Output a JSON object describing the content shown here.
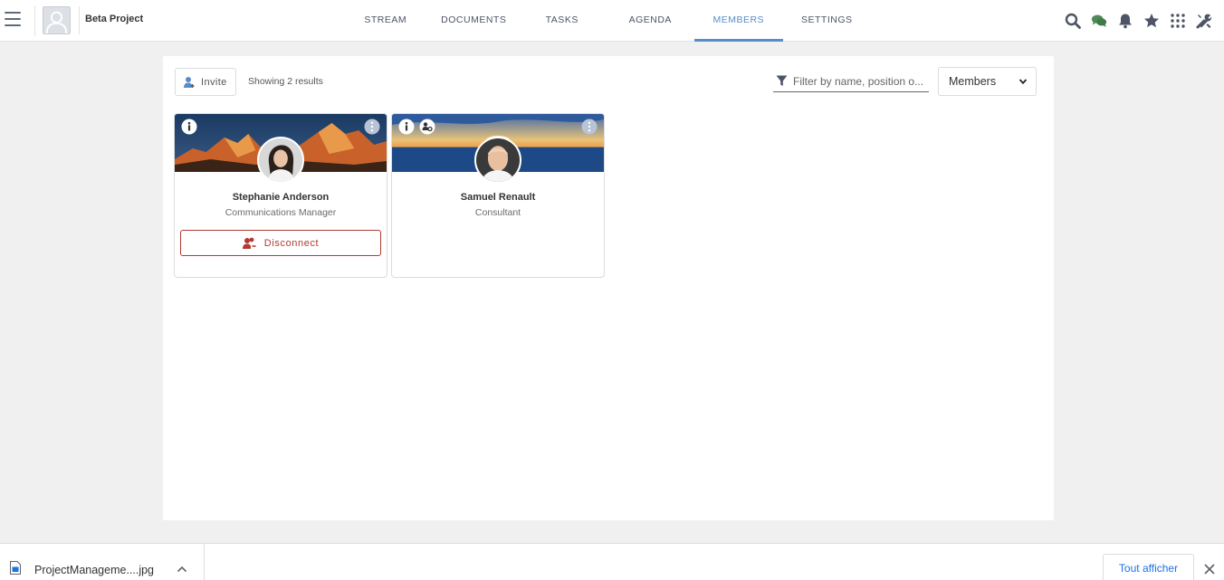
{
  "space": {
    "title": "Beta Project"
  },
  "nav": {
    "tabs": [
      {
        "label": "STREAM",
        "active": false
      },
      {
        "label": "DOCUMENTS",
        "active": false
      },
      {
        "label": "TASKS",
        "active": false
      },
      {
        "label": "AGENDA",
        "active": false
      },
      {
        "label": "MEMBERS",
        "active": true
      },
      {
        "label": "SETTINGS",
        "active": false
      }
    ]
  },
  "top_icons": [
    "search-icon",
    "chat-icon",
    "bell-icon",
    "star-icon",
    "apps-grid-icon",
    "tools-icon"
  ],
  "toolbar": {
    "invite_label": "Invite",
    "results_text": "Showing 2 results",
    "filter_placeholder": "Filter by name, position o...",
    "role_select_value": "Members"
  },
  "members": [
    {
      "name": "Stephanie Anderson",
      "position": "Communications Manager",
      "action_label": "Disconnect"
    },
    {
      "name": "Samuel Renault",
      "position": "Consultant"
    }
  ],
  "download_bar": {
    "file_name": "ProjectManageme....jpg",
    "show_all_label": "Tout afficher"
  },
  "colors": {
    "accent": "#578dc9",
    "disconnect": "#b03a32",
    "chat_icon": "#4d8a55",
    "icon_default": "#4d5466"
  }
}
